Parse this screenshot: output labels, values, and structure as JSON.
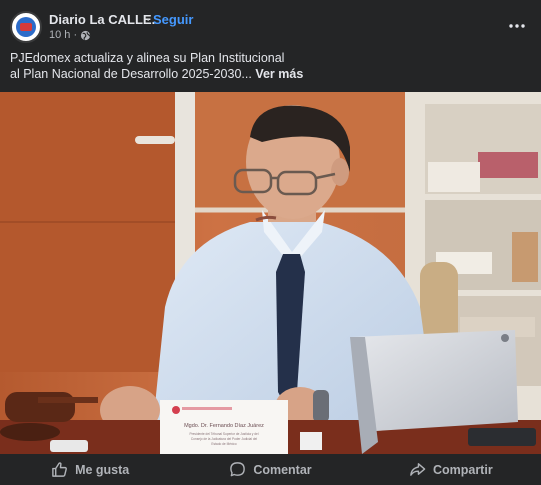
{
  "post": {
    "page_name": "Diario La CALLE.",
    "separator": "·",
    "follow_label": "Seguir",
    "time_ago": "10 h ·",
    "caption_line1": "PJEdomex actualiza y alinea su Plan Institucional",
    "caption_line2": "al Plan Nacional de Desarrollo 2025-2030...",
    "see_more": "Ver más",
    "more_icon": "more-horizontal-icon"
  },
  "photo": {
    "nameplate_title": "Mgdo. Dr. Fernando Díaz Juárez",
    "nameplate_subtitle_1": "Presidente del Tribunal Superior de Justicia y del",
    "nameplate_subtitle_2": "Consejo de la Judicatura del Poder Judicial del",
    "nameplate_subtitle_3": "Estado de México"
  },
  "actions": {
    "like_label": "Me gusta",
    "comment_label": "Comentar",
    "share_label": "Compartir"
  },
  "colors": {
    "background": "#242526",
    "text_primary": "#e4e6eb",
    "text_secondary": "#b0b3b8",
    "link_blue": "#4599ff"
  }
}
